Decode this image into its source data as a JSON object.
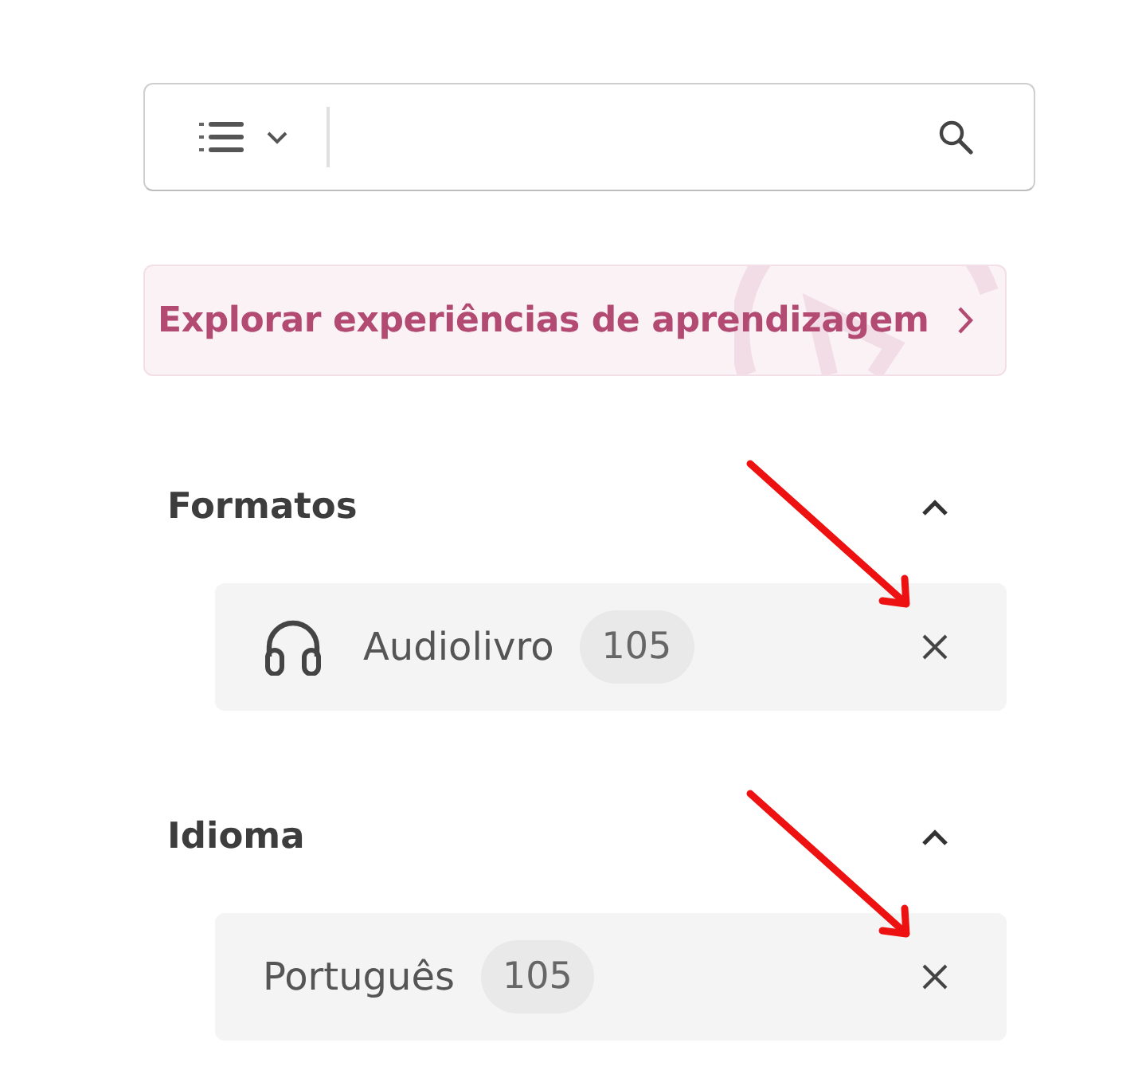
{
  "banner": {
    "label": "Explorar experiências de aprendizagem"
  },
  "filter_groups": [
    {
      "title": "Formatos",
      "expanded": true,
      "filters": [
        {
          "kind": "format",
          "label": "Audiolivro",
          "count": "105",
          "annotated": true
        }
      ]
    },
    {
      "title": "Idioma",
      "expanded": true,
      "filters": [
        {
          "kind": "language",
          "label": "Português",
          "count": "105",
          "annotated": true
        }
      ]
    }
  ]
}
